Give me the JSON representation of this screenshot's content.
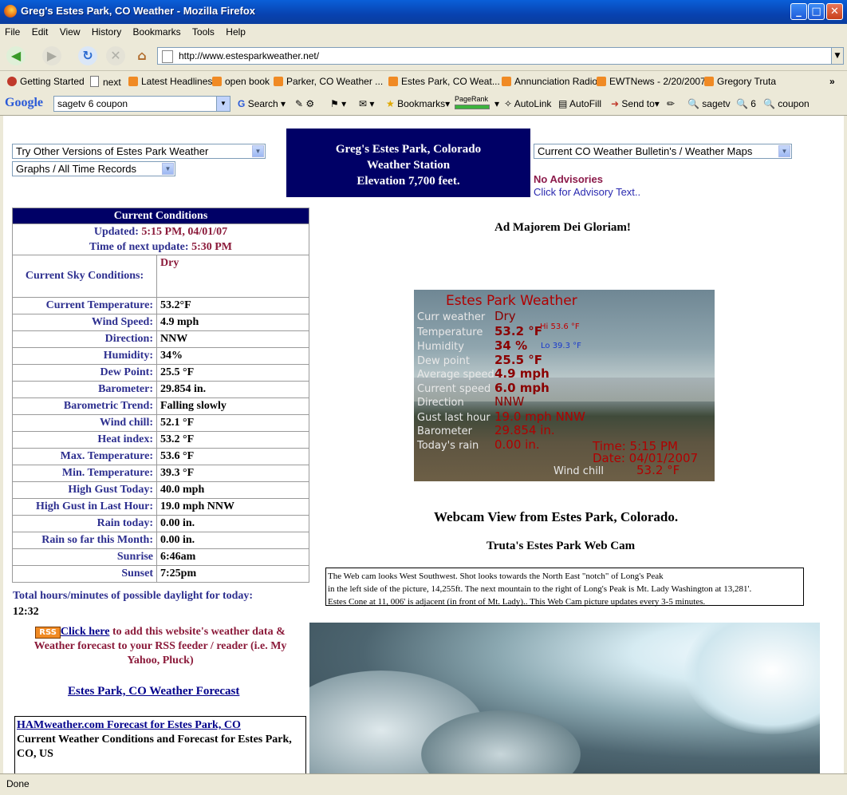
{
  "window": {
    "title": "Greg's Estes Park, CO Weather - Mozilla Firefox",
    "minimize": "_",
    "maximize": "□",
    "close": "✕"
  },
  "menu": [
    "File",
    "Edit",
    "View",
    "History",
    "Bookmarks",
    "Tools",
    "Help"
  ],
  "nav": {
    "back": "◀",
    "forward": "▶",
    "reload": "↻",
    "stop": "✕",
    "home": "⌂",
    "url": "http://www.estesparkweather.net/"
  },
  "bookmarks": [
    "Getting Started",
    "next",
    "Latest Headlines",
    "open book",
    "Parker, CO Weather ...",
    "Estes Park, CO Weat...",
    "Annunciation Radio",
    "EWTNews - 2/20/2007",
    "Gregory Truta"
  ],
  "google_toolbar": {
    "logo": "Google",
    "query": "sagetv 6 coupon",
    "search": "Search",
    "bookmarks": "Bookmarks",
    "pagerank": "PageRank",
    "autolink": "AutoLink",
    "autofill": "AutoFill",
    "sendto": "Send to",
    "term1": "sagetv",
    "term2": "6",
    "term3": "coupon"
  },
  "page": {
    "select_versions": "Try Other Versions of Estes Park Weather",
    "select_graphs": "Graphs / All Time Records",
    "station": {
      "line1": "Greg's Estes Park, Colorado",
      "line2": "Weather Station",
      "line3": "Elevation 7,700 feet."
    },
    "select_bulletins": "Current CO Weather Bulletin's / Weather Maps",
    "advisories": "No Advisories",
    "advisory_link": "Click for Advisory Text..",
    "motto": "Ad Majorem Dei Gloriam!",
    "current": {
      "header": "Current Conditions",
      "updated_label": "Updated:",
      "updated_value": "5:15 PM, 04/01/07",
      "next_label": "Time of next update:",
      "next_value": "5:30 PM",
      "sky_label": "Current Sky Conditions:",
      "sky_value": "Dry",
      "rows": [
        {
          "k": "Current Temperature:",
          "v": "53.2°F"
        },
        {
          "k": "Wind Speed:",
          "v": "4.9 mph"
        },
        {
          "k": "Direction:",
          "v": "NNW"
        },
        {
          "k": "Humidity:",
          "v": "34%"
        },
        {
          "k": "Dew Point:",
          "v": "25.5 °F"
        },
        {
          "k": "Barometer:",
          "v": "29.854 in."
        },
        {
          "k": "Barometric Trend:",
          "v": "Falling slowly"
        },
        {
          "k": "Wind chill:",
          "v": "52.1 °F"
        },
        {
          "k": "Heat index:",
          "v": "53.2 °F"
        },
        {
          "k": "Max. Temperature:",
          "v": "53.6 °F"
        },
        {
          "k": "Min. Temperature:",
          "v": "39.3 °F"
        },
        {
          "k": "High Gust Today:",
          "v": "40.0 mph"
        },
        {
          "k": "High Gust in Last Hour:",
          "v": "19.0 mph NNW"
        },
        {
          "k": "Rain today:",
          "v": "0.00 in."
        },
        {
          "k": "Rain so far this Month:",
          "v": "0.00 in."
        },
        {
          "k": "Sunrise",
          "v": "6:46am"
        },
        {
          "k": "Sunset",
          "v": "7:25pm"
        }
      ],
      "daylight_label": "Total hours/minutes of possible daylight for today:",
      "daylight_value": "12:32"
    },
    "rss": {
      "badge": "RSS",
      "link": "Click here",
      "text": " to add this website's weather data & Weather forecast to your RSS feeder / reader (i.e. My Yahoo, Pluck)"
    },
    "forecast_link": "Estes Park, CO Weather Forecast",
    "ham": {
      "link": "HAMweather.com Forecast for Estes Park, CO",
      "text": "Current Weather Conditions and Forecast for Estes Park, CO, US"
    },
    "overlay": {
      "title": "Estes Park Weather",
      "curr_label": "Curr weather",
      "curr_value": "Dry",
      "temp_label": "Temperature",
      "temp_value": "53.2 °F",
      "hi": "Hi 53.6 °F",
      "hum_label": "Humidity",
      "hum_value": "34 %",
      "lo": "Lo 39.3 °F",
      "dew_label": "Dew point",
      "dew_value": "25.5 °F",
      "avg_label": "Average speed",
      "avg_value": "4.9 mph",
      "cur_label": "Current speed",
      "cur_value": "6.0 mph",
      "dir_label": "Direction",
      "dir_value": "NNW",
      "gust_label": "Gust last hour",
      "gust_value": "19.0 mph NNW",
      "baro_label": "Barometer",
      "baro_value": "29.854 in.",
      "rain_label": "Today's rain",
      "rain_value": "0.00 in.",
      "time": "Time: 5:15 PM",
      "date": "Date: 04/01/2007",
      "wc_label": "Wind chill",
      "wc_value": "53.2 °F"
    },
    "webcam_title": "Webcam View from Estes Park, Colorado.",
    "webcam_subtitle": "Truta's Estes Park Web Cam",
    "webcam_desc1": "The Web cam looks West Southwest. Shot looks towards the North East \"notch\" of Long's Peak",
    "webcam_desc2": "in the left side of the picture, 14,255ft.  The next mountain to the right of Long's Peak is Mt. Lady Washington at 13,281'.",
    "webcam_desc3": "Estes Cone at 11, 006' is adjacent (in front of Mt. Lady).. This Web Cam picture updates every 3-5 minutes."
  },
  "status": "Done"
}
